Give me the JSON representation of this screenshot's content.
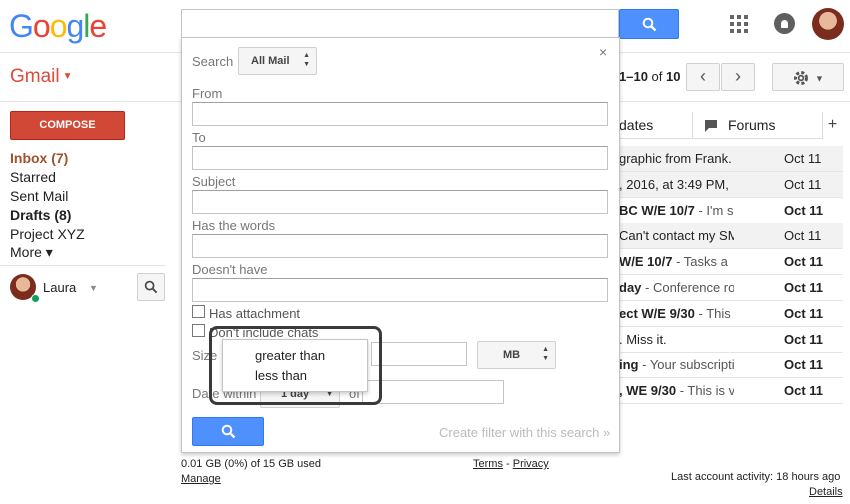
{
  "header": {
    "logo_letters": [
      "G",
      "o",
      "o",
      "g",
      "l",
      "e"
    ],
    "logo_colors": [
      "#4285f4",
      "#ea4335",
      "#fbbc05",
      "#4285f4",
      "#34a853",
      "#ea4335"
    ],
    "search_icon": "search-icon",
    "apps_icon": "apps-grid-icon",
    "notifications_icon": "notifications-icon",
    "avatar_icon": "account-avatar"
  },
  "app": {
    "title": "Gmail",
    "accent": "#dd4b39"
  },
  "toolbar": {
    "pager_range": "1–10",
    "pager_of": "of",
    "pager_total": "10",
    "prev_label": "‹",
    "next_label": "›",
    "settings_icon": "gear-icon"
  },
  "sidebar": {
    "compose_label": "COMPOSE",
    "compose_color": "#d14836",
    "items": [
      {
        "label": "Inbox (7)"
      },
      {
        "label": "Starred"
      },
      {
        "label": "Sent Mail"
      },
      {
        "label": "Drafts (8)"
      },
      {
        "label": "Project XYZ"
      },
      {
        "label": "More ▾"
      }
    ],
    "hangouts_user": "Laura"
  },
  "tabs": [
    {
      "label": "dates"
    },
    {
      "label": "Forums"
    }
  ],
  "tab_plus": "+",
  "messages": [
    {
      "subject": "",
      "snippet": "graphic from Frank. C",
      "date": "Oct 11",
      "unread": false
    },
    {
      "subject": "",
      "snippet": ", 2016, at 3:49 PM,",
      "date": "Oct 11",
      "unread": false
    },
    {
      "subject": "BC W/E 10/7",
      "snippet": " - I'm s",
      "date": "Oct 11",
      "unread": true
    },
    {
      "subject": "",
      "snippet": "Can't contact my SM",
      "date": "Oct 11",
      "unread": false
    },
    {
      "subject": "W/E 10/7",
      "snippet": " - Tasks a",
      "date": "Oct 11",
      "unread": true
    },
    {
      "subject": "day",
      "snippet": " - Conference ro",
      "date": "Oct 11",
      "unread": true
    },
    {
      "subject": "ect W/E 9/30",
      "snippet": " - This",
      "date": "Oct 11",
      "unread": true
    },
    {
      "subject": "",
      "snippet": ". Miss it.",
      "date": "Oct 11",
      "unread": true
    },
    {
      "subject": "ing",
      "snippet": " - Your subscripti",
      "date": "Oct 11",
      "unread": true
    },
    {
      "subject": ", WE 9/30",
      "snippet": " - This is v",
      "date": "Oct 11",
      "unread": true
    }
  ],
  "footer": {
    "storage": "0.01 GB (0%) of 15 GB used",
    "manage": "Manage",
    "terms": "Terms",
    "dash": " - ",
    "privacy": "Privacy",
    "activity": "Last account activity: 18 hours ago",
    "details": "Details"
  },
  "advanced_search": {
    "close": "×",
    "search_label": "Search",
    "search_scope": "All Mail",
    "from_label": "From",
    "from_value": "",
    "to_label": "To",
    "to_value": "",
    "subject_label": "Subject",
    "subject_value": "",
    "has_words_label": "Has the words",
    "has_words_value": "",
    "doesnt_have_label": "Doesn't have",
    "doesnt_have_value": "",
    "has_attachment_label": "Has attachment",
    "has_attachment_checked": false,
    "dont_include_chats_label": "Don't include chats",
    "dont_include_chats_checked": false,
    "size_label": "Size",
    "size_value": "",
    "size_unit": "MB",
    "date_within_label": "Date within",
    "date_within_value": "1 day",
    "of_label": "of",
    "date_value": "",
    "search_button_icon": "search-icon",
    "create_filter": "Create filter with this search »",
    "size_operator_options": [
      "greater than",
      "less than"
    ]
  }
}
